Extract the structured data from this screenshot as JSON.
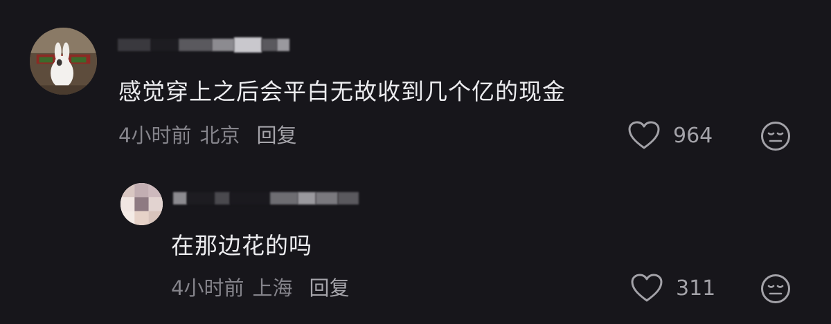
{
  "comments": [
    {
      "text": "感觉穿上之后会平白无故收到几个亿的现金",
      "time": "4小时前",
      "location": "北京",
      "reply_label": "回复",
      "likes": "964",
      "username": ""
    },
    {
      "text": "在那边花的吗",
      "time": "4小时前",
      "location": "上海",
      "reply_label": "回复",
      "likes": "311",
      "username": ""
    }
  ],
  "icons": {
    "like": "heart-outline-icon",
    "emoji": "neutral-face-icon"
  },
  "colors": {
    "background": "#17161b",
    "comment_text": "#ececef",
    "meta_text": "#85848b",
    "icon": "#a3a2a8"
  }
}
